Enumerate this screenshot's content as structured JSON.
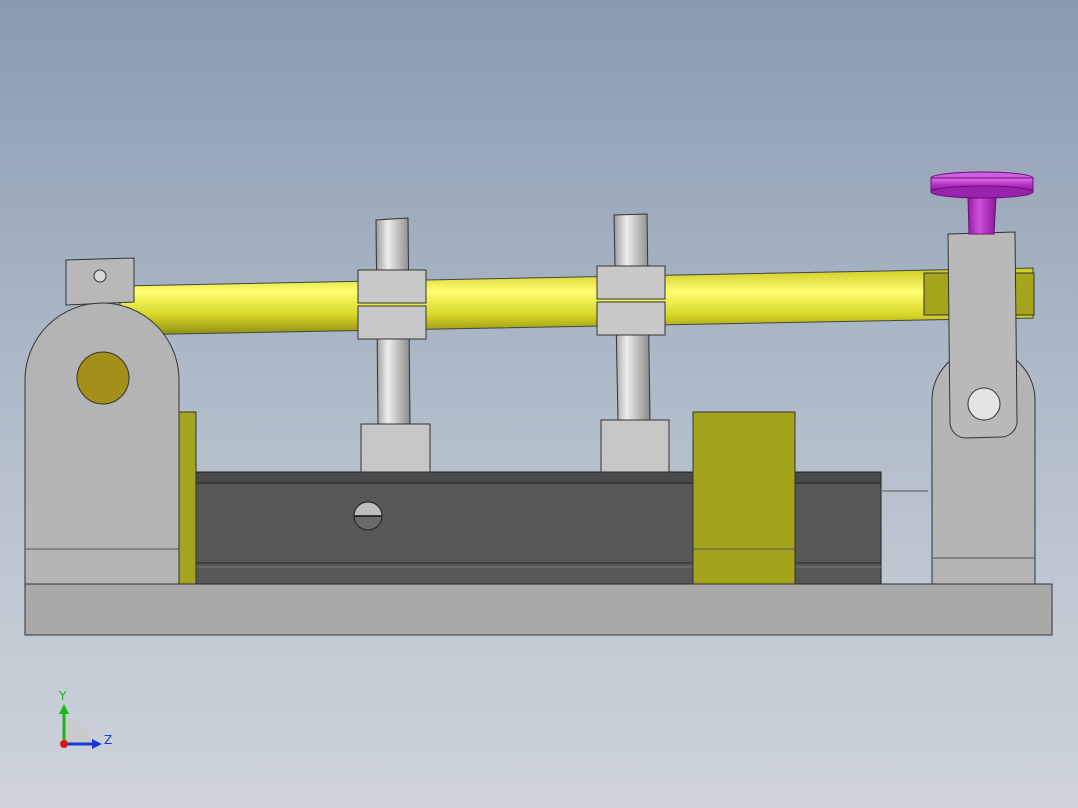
{
  "viewport": {
    "background_top": "#8a9bb0",
    "background_bottom": "#cfd4db"
  },
  "model": {
    "parts": [
      {
        "name": "base-plate",
        "color": "#a8a8a8"
      },
      {
        "name": "left-pivot-block",
        "color": "#b4b4b4"
      },
      {
        "name": "pivot-pin",
        "color": "#a48f18"
      },
      {
        "name": "lever-bar",
        "color": "#e8e840"
      },
      {
        "name": "clamp-post",
        "color": "#c9c9c9"
      },
      {
        "name": "dark-slide-rail",
        "color": "#585858"
      },
      {
        "name": "olive-slider-block",
        "color": "#a3a31c"
      },
      {
        "name": "right-support-block",
        "color": "#b4b4b4"
      },
      {
        "name": "purple-knob",
        "color": "#b030c0"
      }
    ]
  },
  "triad": {
    "y_label": "Y",
    "z_label": "Z",
    "y_color": "#18b818",
    "z_color": "#1838d8",
    "x_color": "#d81818"
  }
}
